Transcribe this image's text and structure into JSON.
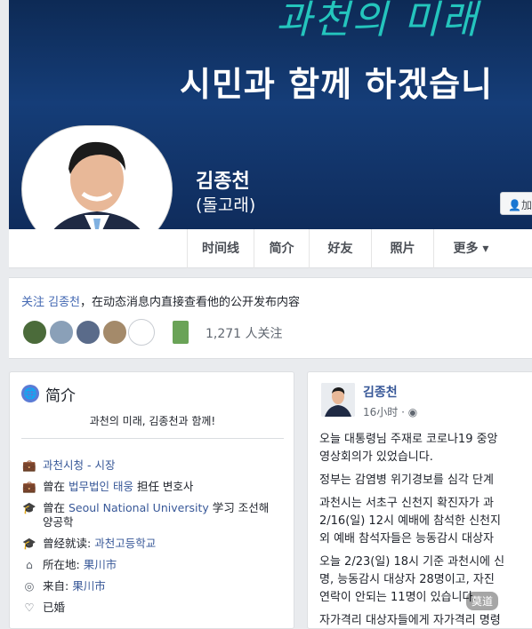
{
  "cover": {
    "script_text": "과천의 미래",
    "headline": "시민과 함께 하겠습니",
    "name": "김종천",
    "alias": "(돌고래)",
    "add_button": "加"
  },
  "tabs": [
    {
      "label": "时间线"
    },
    {
      "label": "简介"
    },
    {
      "label": "好友"
    },
    {
      "label": "照片"
    },
    {
      "label": "更多 ▾"
    }
  ],
  "follow": {
    "prefix": "关注 ",
    "name": "김종천",
    "suffix": "，在动态消息内直接查看他的公开发布内容",
    "count": "1,271 人关注"
  },
  "intro": {
    "title": "简介",
    "slogan": "과천의 미래, 김종천과 함께!",
    "rows": [
      {
        "text": "과천시청 - 시장"
      },
      {
        "pre": "曾在 ",
        "link": "법무법인 태웅",
        "post": " 担任 변호사"
      },
      {
        "pre": "曾在 ",
        "link": "Seoul National University",
        "post": " 学习 조선해"
      },
      {
        "text": "양공학"
      },
      {
        "pre": "曾经就读: ",
        "link": "과천고등학교",
        "post": ""
      },
      {
        "pre": "所在地: ",
        "link": "果川市",
        "post": ""
      },
      {
        "pre": "来自: ",
        "link": "果川市",
        "post": ""
      },
      {
        "text": "已婚"
      }
    ]
  },
  "post": {
    "author": "김종천",
    "time": "16小时 · ◉",
    "lines": [
      "오늘 대통령님 주재로 코로나19 중앙",
      "영상회의가 있었습니다.",
      "정부는 감염병 위기경보를 심각 단계",
      "과천시는 서초구 신천지 확진자가 과",
      "2/16(일) 12시 예배에 참석한 신천지",
      "외 예배 참석자들은 능동감시 대상자",
      "오늘 2/23(일) 18시 기준 과천시에 신",
      "명, 능동감시 대상자 28명이고, 자진",
      "연락이 안되는 11명이 있습니다.",
      "자가격리 대상자들에게 자가격리 명령"
    ]
  },
  "watermark": "莫道"
}
